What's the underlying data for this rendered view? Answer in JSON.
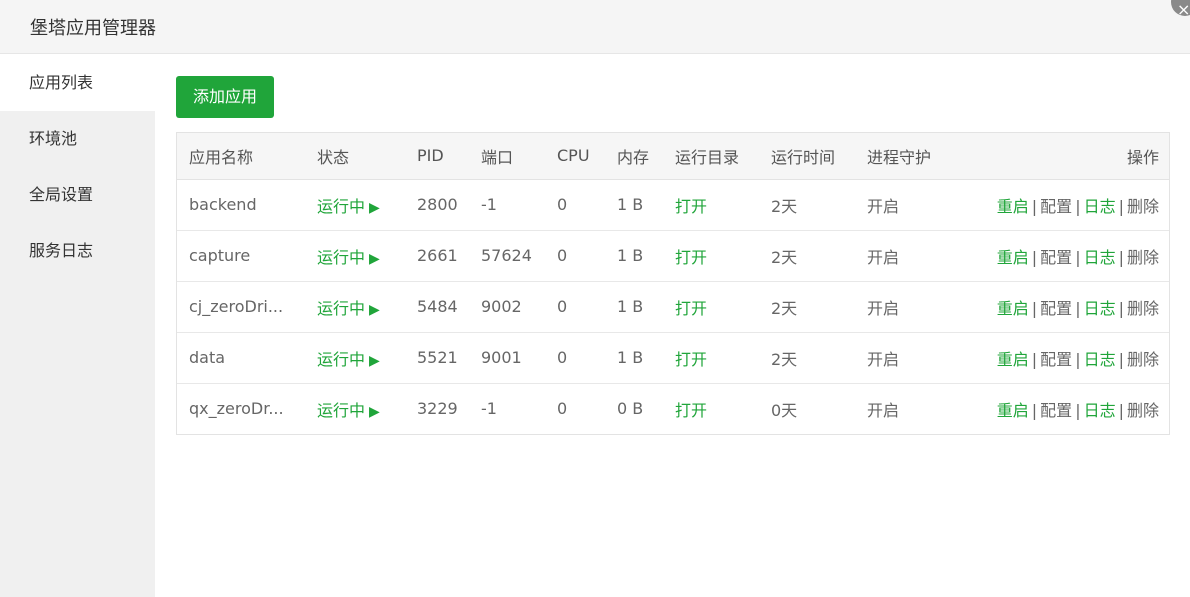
{
  "window": {
    "title": "堡塔应用管理器",
    "close_icon": "×"
  },
  "sidebar": {
    "items": [
      {
        "label": "应用列表",
        "active": true
      },
      {
        "label": "环境池",
        "active": false
      },
      {
        "label": "全局设置",
        "active": false
      },
      {
        "label": "服务日志",
        "active": false
      }
    ]
  },
  "toolbar": {
    "add_label": "添加应用"
  },
  "table": {
    "headers": {
      "name": "应用名称",
      "status": "状态",
      "pid": "PID",
      "port": "端口",
      "cpu": "CPU",
      "mem": "内存",
      "dir": "运行目录",
      "time": "运行时间",
      "guard": "进程守护",
      "ops": "操作"
    },
    "rows": [
      {
        "name": "backend",
        "status": "运行中",
        "pid": "2800",
        "port": "-1",
        "cpu": "0",
        "mem": "1 B",
        "dir": "打开",
        "time": "2天",
        "guard": "开启"
      },
      {
        "name": "capture",
        "status": "运行中",
        "pid": "2661",
        "port": "57624",
        "cpu": "0",
        "mem": "1 B",
        "dir": "打开",
        "time": "2天",
        "guard": "开启"
      },
      {
        "name": "cj_zeroDri...",
        "status": "运行中",
        "pid": "5484",
        "port": "9002",
        "cpu": "0",
        "mem": "1 B",
        "dir": "打开",
        "time": "2天",
        "guard": "开启"
      },
      {
        "name": "data",
        "status": "运行中",
        "pid": "5521",
        "port": "9001",
        "cpu": "0",
        "mem": "1 B",
        "dir": "打开",
        "time": "2天",
        "guard": "开启"
      },
      {
        "name": "qx_zeroDr...",
        "status": "运行中",
        "pid": "3229",
        "port": "-1",
        "cpu": "0",
        "mem": "0 B",
        "dir": "打开",
        "time": "0天",
        "guard": "开启"
      }
    ],
    "actions": {
      "restart": "重启",
      "config": "配置",
      "log": "日志",
      "delete": "删除",
      "separator": "|",
      "play_icon": "▶"
    }
  },
  "colors": {
    "accent": "#20a53a",
    "sidebar_bg": "#f0f0f0",
    "header_bg": "#f6f6f6"
  }
}
